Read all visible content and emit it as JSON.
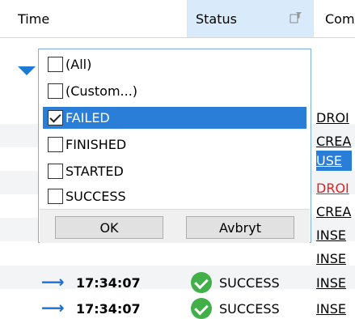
{
  "columns": {
    "time": "Time",
    "status": "Status",
    "command": "Com"
  },
  "commands": [
    "DROI",
    "CREA",
    "USE",
    "DROI",
    "CREA",
    "INSE",
    "INSE",
    "INSE"
  ],
  "bottom_rows": [
    {
      "time": "17:34:07",
      "status": "SUCCESS",
      "command": "INSE"
    },
    {
      "time": "17:34:07",
      "status": "SUCCESS",
      "command": "INSE"
    }
  ],
  "filter_popup": {
    "options": [
      {
        "label": "(All)",
        "checked": false
      },
      {
        "label": "(Custom...)",
        "checked": false
      },
      {
        "label": "FAILED",
        "checked": true
      },
      {
        "label": "FINISHED",
        "checked": false
      },
      {
        "label": "STARTED",
        "checked": false
      },
      {
        "label": "SUCCESS",
        "checked": false
      }
    ],
    "ok_label": "OK",
    "cancel_label": "Avbryt"
  },
  "icons": {
    "filter": "filter-icon",
    "arrow": "right-arrow-icon",
    "success": "success-check-icon",
    "expand": "expand-triangle-icon"
  },
  "colors": {
    "selection": "#2a7ed7",
    "header_active": "#d9ebfb",
    "success": "#41b049",
    "error_text": "#e02020"
  }
}
